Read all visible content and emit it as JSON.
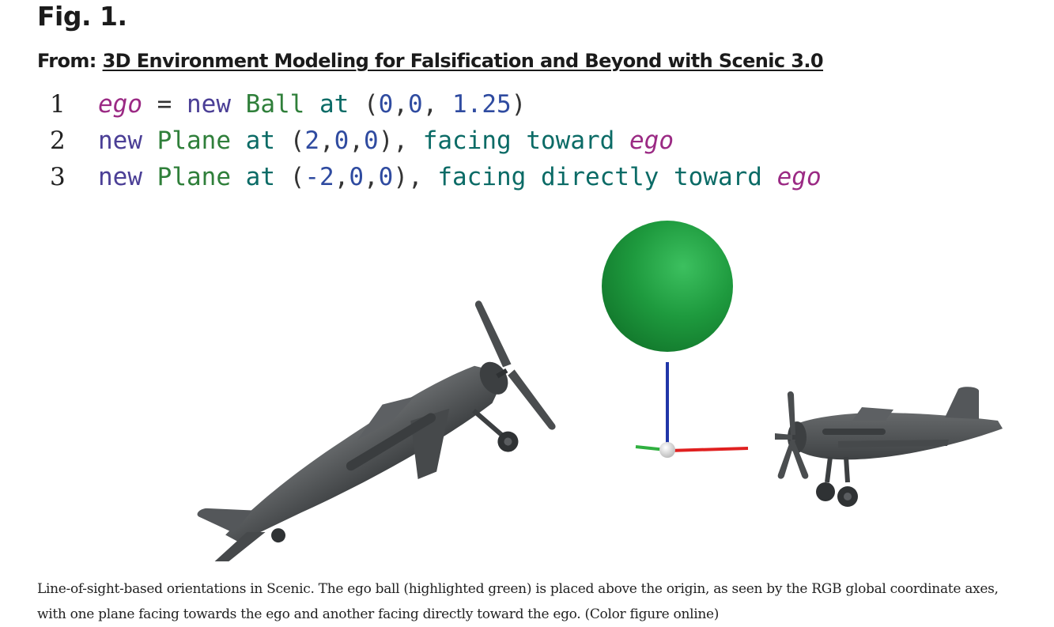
{
  "figure": {
    "label": "Fig. 1.",
    "from_prefix": "From:",
    "from_link": "3D Environment Modeling for Falsification and Beyond with Scenic 3.0"
  },
  "code": {
    "lines": [
      {
        "number": "1",
        "tokens": [
          {
            "text": "ego",
            "kind": "ego"
          },
          {
            "text": " = ",
            "kind": "punc"
          },
          {
            "text": "new",
            "kind": "new"
          },
          {
            "text": " ",
            "kind": "punc"
          },
          {
            "text": "Ball",
            "kind": "class"
          },
          {
            "text": " ",
            "kind": "punc"
          },
          {
            "text": "at",
            "kind": "op"
          },
          {
            "text": " (",
            "kind": "punc"
          },
          {
            "text": "0",
            "kind": "num"
          },
          {
            "text": ",",
            "kind": "punc"
          },
          {
            "text": "0",
            "kind": "num"
          },
          {
            "text": ", ",
            "kind": "punc"
          },
          {
            "text": "1.25",
            "kind": "num"
          },
          {
            "text": ")",
            "kind": "punc"
          }
        ]
      },
      {
        "number": "2",
        "tokens": [
          {
            "text": "new",
            "kind": "new"
          },
          {
            "text": " ",
            "kind": "punc"
          },
          {
            "text": "Plane",
            "kind": "class"
          },
          {
            "text": " ",
            "kind": "punc"
          },
          {
            "text": "at",
            "kind": "op"
          },
          {
            "text": " (",
            "kind": "punc"
          },
          {
            "text": "2",
            "kind": "num"
          },
          {
            "text": ",",
            "kind": "punc"
          },
          {
            "text": "0",
            "kind": "num"
          },
          {
            "text": ",",
            "kind": "punc"
          },
          {
            "text": "0",
            "kind": "num"
          },
          {
            "text": "), ",
            "kind": "punc"
          },
          {
            "text": "facing toward",
            "kind": "op"
          },
          {
            "text": " ",
            "kind": "punc"
          },
          {
            "text": "ego",
            "kind": "ego"
          }
        ]
      },
      {
        "number": "3",
        "tokens": [
          {
            "text": "new",
            "kind": "new"
          },
          {
            "text": " ",
            "kind": "punc"
          },
          {
            "text": "Plane",
            "kind": "class"
          },
          {
            "text": " ",
            "kind": "punc"
          },
          {
            "text": "at",
            "kind": "op"
          },
          {
            "text": " (",
            "kind": "punc"
          },
          {
            "text": "-2",
            "kind": "num"
          },
          {
            "text": ",",
            "kind": "punc"
          },
          {
            "text": "0",
            "kind": "num"
          },
          {
            "text": ",",
            "kind": "punc"
          },
          {
            "text": "0",
            "kind": "num"
          },
          {
            "text": "), ",
            "kind": "punc"
          },
          {
            "text": "facing directly toward",
            "kind": "op"
          },
          {
            "text": " ",
            "kind": "punc"
          },
          {
            "text": "ego",
            "kind": "ego"
          }
        ]
      }
    ]
  },
  "render": {
    "ball_color": "#1e9a3e",
    "plane_color": "#4f5254",
    "axis_colors": {
      "x": "#e02020",
      "y": "#30b040",
      "z": "#2036a8"
    }
  },
  "caption": "Line-of-sight-based orientations in Scenic. The ego ball (highlighted green) is placed above the origin, as seen by the RGB global coordinate axes, with one plane facing towards the ego and another facing directly toward the ego. (Color figure online)"
}
